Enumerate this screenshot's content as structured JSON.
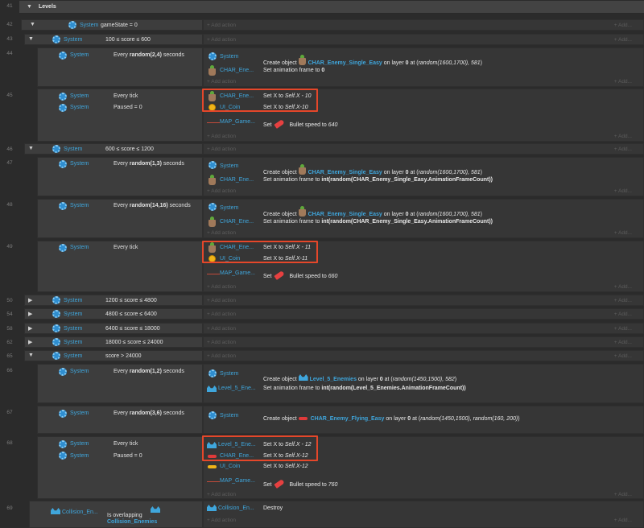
{
  "group": {
    "line": "41",
    "name": "Levels"
  },
  "common": {
    "system": "System",
    "add_action": "+ Add action",
    "add_right": "+ Add..."
  },
  "ev42": {
    "line": "42",
    "cond": "gameState = 0"
  },
  "ev43": {
    "line": "43",
    "cond": "100 ≤ score ≤ 600"
  },
  "ev44": {
    "line": "44",
    "cond_pre": "Every ",
    "cond_b": "random(2,4)",
    "cond_post": " seconds",
    "a1_obj": "System",
    "a1_pre": "Create object ",
    "a1_name": "CHAR_Enemy_Single_Easy",
    "a1_mid": " on layer ",
    "a1_layer": "0",
    "a1_at": " at (",
    "a1_args": "random(1600,1700), 581",
    "a1_end": ")",
    "a2_obj": "CHAR_Ene...",
    "a2_pre": "Set animation frame to ",
    "a2_val": "0"
  },
  "ev45": {
    "line": "45",
    "c1": "Every tick",
    "c2": "Paused = 0",
    "a1_obj": "CHAR_Ene...",
    "a1_pre": "Set X to ",
    "a1_val": "Self.X - 10",
    "a2_obj": "UI_Coin",
    "a2_pre": "Set X to ",
    "a2_val": "Self.X-10",
    "a3_obj": "MAP_Game...",
    "a3_pre": "Set ",
    "a3_post": "Bullet speed to ",
    "a3_val": "640"
  },
  "ev46": {
    "line": "46",
    "cond": "600 ≤ score ≤ 1200"
  },
  "ev47": {
    "line": "47",
    "cond_pre": "Every ",
    "cond_b": "random(1,3)",
    "cond_post": " seconds",
    "a1_obj": "System",
    "a1_pre": "Create object ",
    "a1_name": "CHAR_Enemy_Single_Easy",
    "a1_mid": " on layer ",
    "a1_layer": "0",
    "a1_at": " at (",
    "a1_args": "random(1600,1700), 581",
    "a1_end": ")",
    "a2_obj": "CHAR_Ene...",
    "a2_pre": "Set animation frame to ",
    "a2_val": "int(random(CHAR_Enemy_Single_Easy.AnimationFrameCount))"
  },
  "ev48": {
    "line": "48",
    "cond_pre": "Every ",
    "cond_b": "random(14,16)",
    "cond_post": " seconds",
    "a1_obj": "System",
    "a1_pre": "Create object ",
    "a1_name": "CHAR_Enemy_Single_Easy",
    "a1_mid": " on layer ",
    "a1_layer": "0",
    "a1_at": " at (",
    "a1_args": "random(1600,1700), 581",
    "a1_end": ")",
    "a2_obj": "CHAR_Ene...",
    "a2_pre": "Set animation frame to ",
    "a2_val": "int(random(CHAR_Enemy_Single_Easy.AnimationFrameCount))"
  },
  "ev49": {
    "line": "49",
    "c1": "Every tick",
    "a1_obj": "CHAR_Ene...",
    "a1_pre": "Set X to ",
    "a1_val": "Self.X - 11",
    "a2_obj": "UI_Coin",
    "a2_pre": "Set X to ",
    "a2_val": "Self.X-11",
    "a3_obj": "MAP_Game...",
    "a3_pre": "Set ",
    "a3_post": "Bullet speed to ",
    "a3_val": "660"
  },
  "ev50": {
    "line": "50",
    "cond": "1200 ≤ score ≤ 4800"
  },
  "ev54": {
    "line": "54",
    "cond": "4800 ≤ score ≤ 6400"
  },
  "ev58": {
    "line": "58",
    "cond": "6400 ≤ score ≤ 18000"
  },
  "ev62": {
    "line": "62",
    "cond": "18000 ≤ score ≤ 24000"
  },
  "ev65": {
    "line": "65",
    "cond": "score > 24000"
  },
  "ev66": {
    "line": "66",
    "cond_pre": "Every ",
    "cond_b": "random(1,2)",
    "cond_post": " seconds",
    "a1_obj": "System",
    "a1_pre": "Create object ",
    "a1_name": "Level_5_Enemies",
    "a1_mid": " on layer ",
    "a1_layer": "0",
    "a1_at": " at (",
    "a1_args": "random(1450,1500), 582",
    "a1_end": ")",
    "a2_obj": "Level_5_Ene...",
    "a2_pre": "Set animation frame to ",
    "a2_val": "int(random(Level_5_Enemies.AnimationFrameCount))"
  },
  "ev67": {
    "line": "67",
    "cond_pre": "Every ",
    "cond_b": "random(3,6)",
    "cond_post": " seconds",
    "a1_obj": "System",
    "a1_pre": "Create object ",
    "a1_name": "CHAR_Enemy_Flying_Easy",
    "a1_mid": " on layer ",
    "a1_layer": "0",
    "a1_at": " at (",
    "a1_args": "random(1450,1500), random(160, 200)",
    "a1_end": ")"
  },
  "ev68": {
    "line": "68",
    "c1": "Every tick",
    "c2": "Paused = 0",
    "a1_obj": "Level_5_Ene...",
    "a1_pre": "Set X to ",
    "a1_val": "Self.X - 12",
    "a2_obj": "CHAR_Ene...",
    "a2_pre": "Set X to ",
    "a2_val": "Self.X-12",
    "a3_obj": "UI_Coin",
    "a3_pre": "Set X to ",
    "a3_val": "Self.X-12",
    "a4_obj": "MAP_Game...",
    "a4_pre": "Set ",
    "a4_post": "Bullet speed to ",
    "a4_val": "760"
  },
  "ev69": {
    "line": "69",
    "c_obj": "Collision_En...",
    "c_text": "Is overlapping",
    "c_target": "Collision_Enemies",
    "a1_obj": "Collision_En...",
    "a1_text": "Destroy"
  },
  "colors": {
    "accent": "#3fa6dc",
    "highlight": "#e5472a",
    "background": "#2b2b2b"
  }
}
